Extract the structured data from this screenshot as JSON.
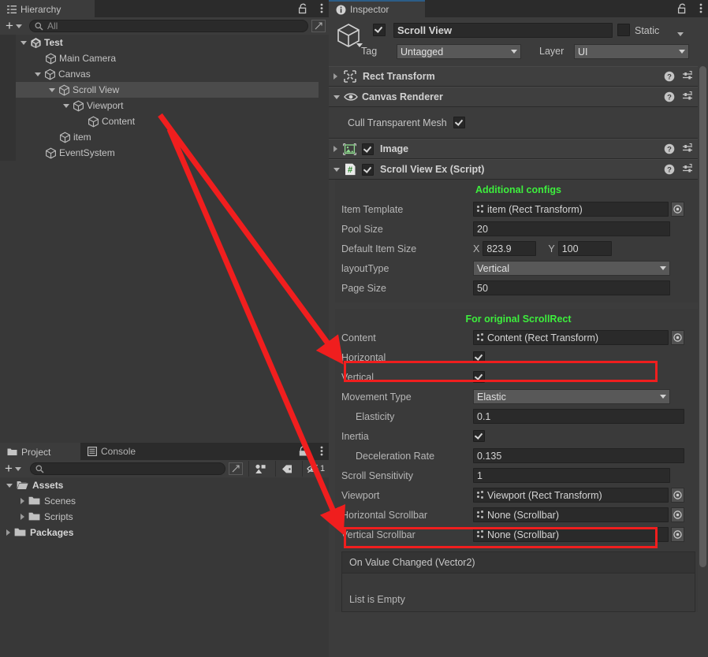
{
  "hierarchy": {
    "tab_label": "Hierarchy",
    "tab_icon": "hierarchy-icon",
    "lock_icon": "lock-open-icon",
    "menu_icon": "kebab-menu-icon",
    "add_label": "+",
    "search_placeholder": "All",
    "search_value": "",
    "rows": [
      {
        "label": "Test",
        "indent": 0,
        "expanded": true,
        "icon": "unity-scene-icon",
        "selected": false,
        "bold": true,
        "kebab": true
      },
      {
        "label": "Main Camera",
        "indent": 1,
        "expanded": null,
        "icon": "gameobject-icon",
        "selected": false,
        "bold": false,
        "kebab": false
      },
      {
        "label": "Canvas",
        "indent": 1,
        "expanded": true,
        "icon": "gameobject-icon",
        "selected": false,
        "bold": false,
        "kebab": false
      },
      {
        "label": "Scroll View",
        "indent": 2,
        "expanded": true,
        "icon": "gameobject-icon",
        "selected": true,
        "bold": false,
        "kebab": false
      },
      {
        "label": "Viewport",
        "indent": 3,
        "expanded": true,
        "icon": "gameobject-icon",
        "selected": false,
        "bold": false,
        "kebab": false
      },
      {
        "label": "Content",
        "indent": 4,
        "expanded": null,
        "icon": "gameobject-icon",
        "selected": false,
        "bold": false,
        "kebab": false
      },
      {
        "label": "item",
        "indent": 2,
        "expanded": null,
        "icon": "gameobject-icon",
        "selected": false,
        "bold": false,
        "kebab": false
      },
      {
        "label": "EventSystem",
        "indent": 1,
        "expanded": null,
        "icon": "gameobject-icon",
        "selected": false,
        "bold": false,
        "kebab": false
      }
    ]
  },
  "project": {
    "tabs": [
      {
        "label": "Project",
        "icon": "folder-icon",
        "active": true
      },
      {
        "label": "Console",
        "icon": "console-icon",
        "active": false
      }
    ],
    "lock_icon": "lock-closed-icon",
    "menu_icon": "kebab-menu-icon",
    "add_label": "+",
    "search_placeholder": "",
    "search_value": "",
    "toolbar_icons": [
      "asset-filter-icon",
      "label-filter-icon",
      "visibility-off-icon"
    ],
    "visibility_count": "1",
    "rows": [
      {
        "label": "Assets",
        "indent": 0,
        "expanded": true,
        "icon": "folder-open-icon",
        "bold": true
      },
      {
        "label": "Scenes",
        "indent": 1,
        "expanded": false,
        "icon": "folder-icon",
        "bold": false
      },
      {
        "label": "Scripts",
        "indent": 1,
        "expanded": false,
        "icon": "folder-icon",
        "bold": false
      },
      {
        "label": "Packages",
        "indent": 0,
        "expanded": false,
        "icon": "folder-icon",
        "bold": true
      }
    ]
  },
  "inspector": {
    "tab_label": "Inspector",
    "tab_icon": "info-icon",
    "lock_icon": "lock-open-icon",
    "menu_icon": "kebab-menu-icon",
    "object_header": {
      "prefab_icon": "gameobject-icon",
      "enabled": true,
      "name_value": "Scroll View",
      "static_checked": false,
      "static_label": "Static",
      "tag_label": "Tag",
      "tag_value": "Untagged",
      "layer_label": "Layer",
      "layer_value": "UI"
    },
    "components": [
      {
        "title": "Rect Transform",
        "icon": "rect-transform-icon",
        "expanded": false,
        "has_toggle": false,
        "enabled": null
      },
      {
        "title": "Canvas Renderer",
        "icon": "eye-icon",
        "expanded": true,
        "has_toggle": false,
        "enabled": null
      },
      {
        "title": "Image",
        "icon": "image-icon",
        "expanded": false,
        "has_toggle": true,
        "enabled": true
      },
      {
        "title": "Scroll View Ex (Script)",
        "icon": "cs-script-icon",
        "expanded": true,
        "has_toggle": true,
        "enabled": true
      }
    ],
    "canvas_renderer": {
      "cull_label": "Cull Transparent Mesh",
      "cull_checked": true
    },
    "help_icon": "help-icon",
    "preset_icon": "preset-icon",
    "kebab_icon": "kebab-menu-icon",
    "section_additional": {
      "title": "Additional configs",
      "title_color": "#3dee3d",
      "fields": [
        {
          "label": "Item Template",
          "type": "object",
          "value": "item (Rect Transform)"
        },
        {
          "label": "Pool Size",
          "type": "text",
          "value": "20"
        },
        {
          "label": "Default Item Size",
          "type": "vector2",
          "x_label": "X",
          "x": "823.9",
          "y_label": "Y",
          "y": "100"
        },
        {
          "label": "layoutType",
          "type": "popup",
          "value": "Vertical"
        },
        {
          "label": "Page Size",
          "type": "text",
          "value": "50"
        }
      ]
    },
    "section_scrollrect": {
      "title": "For original ScrollRect",
      "title_color": "#3dee3d",
      "fields": [
        {
          "label": "Content",
          "type": "object",
          "value": "Content (Rect Transform)",
          "highlight": true
        },
        {
          "label": "Horizontal",
          "type": "checkbox",
          "value": true
        },
        {
          "label": "Vertical",
          "type": "checkbox",
          "value": true
        },
        {
          "label": "Movement Type",
          "type": "popup",
          "value": "Elastic"
        },
        {
          "label": "Elasticity",
          "type": "text",
          "value": "0.1",
          "indent": true
        },
        {
          "label": "Inertia",
          "type": "checkbox",
          "value": true
        },
        {
          "label": "Deceleration Rate",
          "type": "text",
          "value": "0.135",
          "indent": true
        },
        {
          "label": "Scroll Sensitivity",
          "type": "text",
          "value": "1"
        },
        {
          "label": "Viewport",
          "type": "object",
          "value": "Viewport (Rect Transform)",
          "highlight": true
        },
        {
          "label": "Horizontal Scrollbar",
          "type": "object",
          "value": "None (Scrollbar)"
        },
        {
          "label": "Vertical Scrollbar",
          "type": "object",
          "value": "None (Scrollbar)"
        }
      ],
      "event_list": {
        "header": "On Value Changed (Vector2)",
        "empty_text": "List is Empty"
      }
    }
  },
  "annotations": {
    "arrow_color": "#f01e1e",
    "highlight_color": "#f01e1e",
    "arrows": [
      {
        "name": "viewport-arrow",
        "from": [
          203,
          146
        ],
        "to": [
          430,
          452
        ]
      },
      {
        "name": "content-arrow",
        "from": [
          215,
          164
        ],
        "to": [
          434,
          666
        ]
      }
    ]
  }
}
